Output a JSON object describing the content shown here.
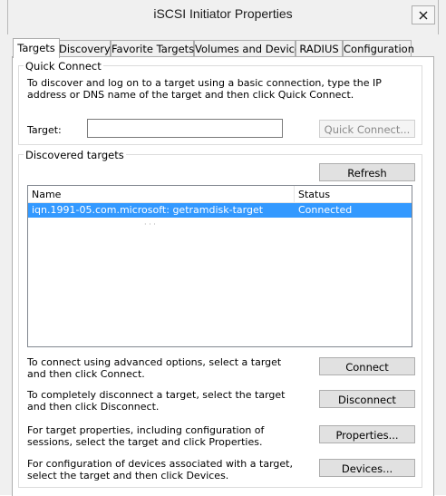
{
  "window": {
    "title": "iSCSI Initiator Properties"
  },
  "tabs": [
    {
      "label": "Targets"
    },
    {
      "label": "Discovery"
    },
    {
      "label": "Favorite Targets"
    },
    {
      "label": "Volumes and Devices"
    },
    {
      "label": "RADIUS"
    },
    {
      "label": "Configuration"
    }
  ],
  "quick_connect": {
    "group_title": "Quick Connect",
    "description": "To discover and log on to a target using a basic connection, type the IP address or DNS name of the target and then click Quick Connect.",
    "target_label": "Target:",
    "target_value": "",
    "button_label": "Quick Connect..."
  },
  "discovered": {
    "group_title": "Discovered targets",
    "refresh_label": "Refresh",
    "columns": {
      "name": "Name",
      "status": "Status"
    },
    "rows": [
      {
        "name": "iqn.1991-05.com.microsoft:                    getramdisk-target",
        "status": "Connected"
      }
    ]
  },
  "actions": [
    {
      "description": "To connect using advanced options, select a target and then click Connect.",
      "button": "Connect"
    },
    {
      "description": "To completely disconnect a target, select the target and then click Disconnect.",
      "button": "Disconnect"
    },
    {
      "description": "For target properties, including configuration of sessions, select the target and click Properties.",
      "button": "Properties..."
    },
    {
      "description": "For configuration of devices associated with a target, select the target and then click Devices.",
      "button": "Devices..."
    }
  ],
  "icons": {
    "close": "close-icon"
  }
}
